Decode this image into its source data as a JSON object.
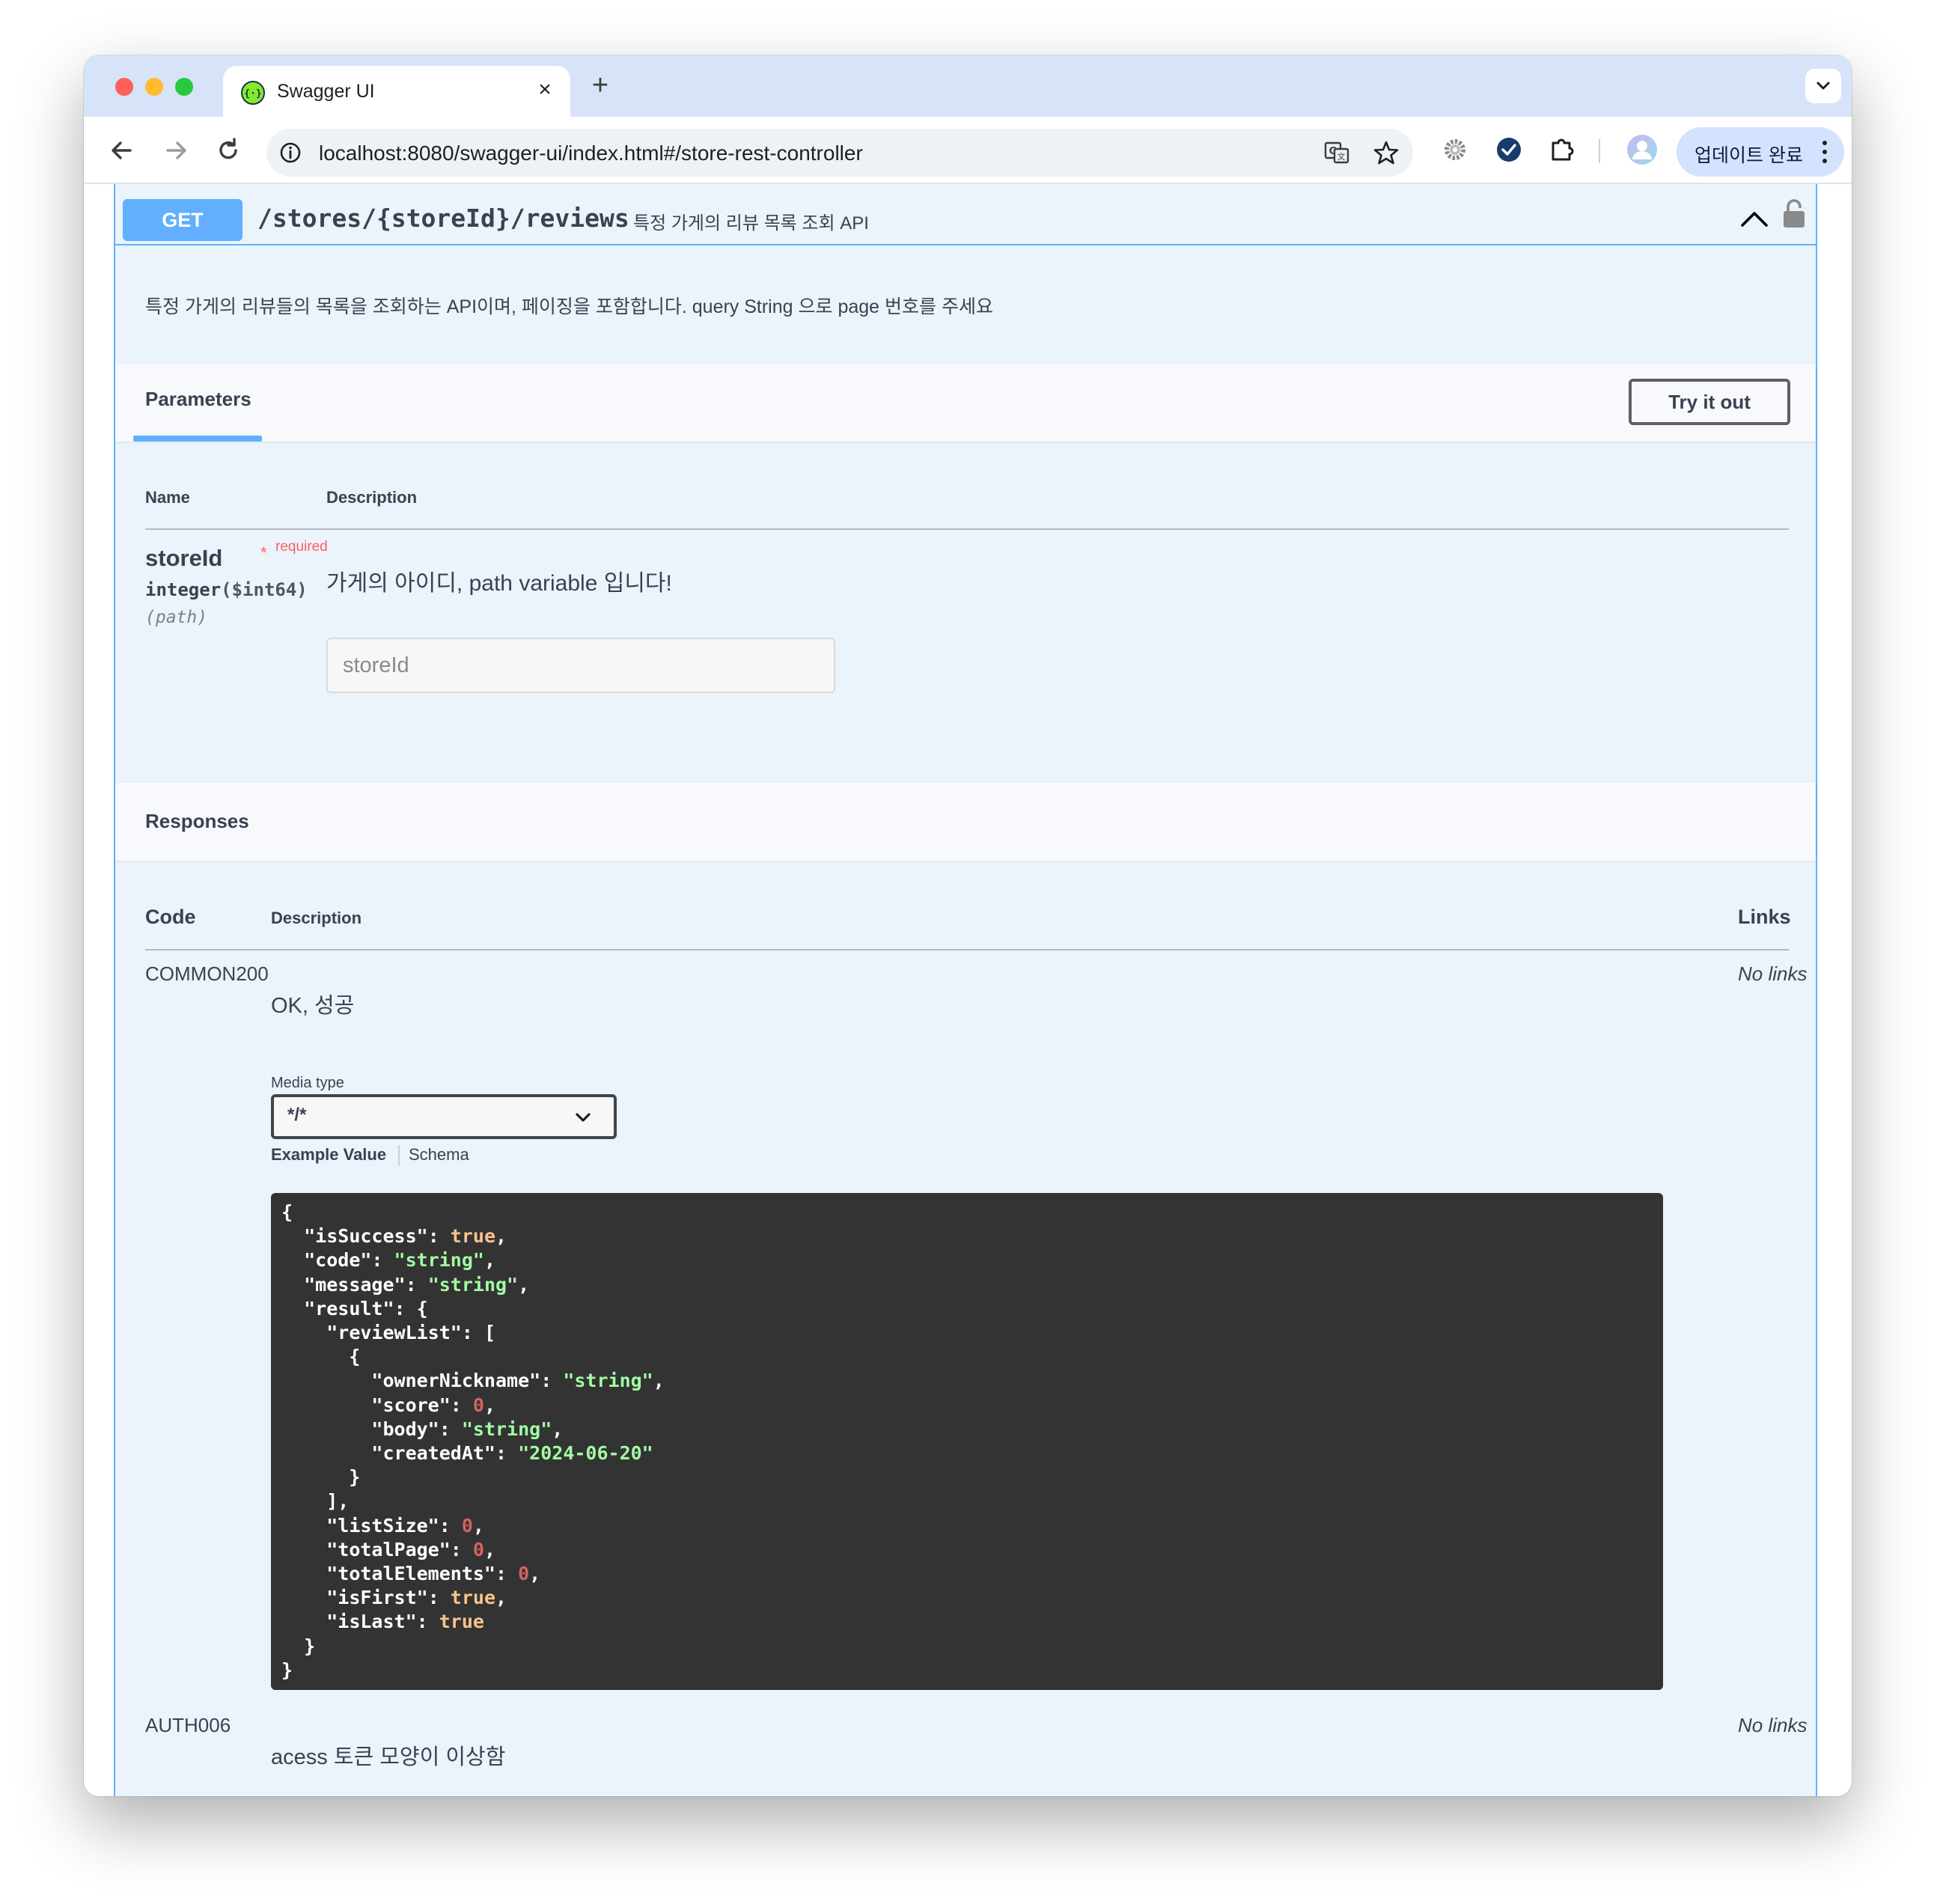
{
  "browser": {
    "tab_title": "Swagger UI",
    "tab_close": "×",
    "new_tab": "+",
    "url": "localhost:8080/swagger-ui/index.html#/store-rest-controller",
    "update_button": "업데이트 완료"
  },
  "operation": {
    "method": "GET",
    "path": "/stores/{storeId}/reviews",
    "summary": "특정 가게의 리뷰 목록 조회 API",
    "description": "특정 가게의 리뷰들의 목록을 조회하는 API이며, 페이징을 포함합니다. query String 으로 page 번호를 주세요"
  },
  "parameters": {
    "tab_label": "Parameters",
    "try_it_out": "Try it out",
    "col_name": "Name",
    "col_description": "Description",
    "items": [
      {
        "name": "storeId",
        "required_star": "*",
        "required_label": "required",
        "type": "integer",
        "format": "($int64)",
        "in": "(path)",
        "description": "가게의 아이디, path variable 입니다!",
        "placeholder": "storeId"
      }
    ]
  },
  "responses": {
    "title": "Responses",
    "col_code": "Code",
    "col_description": "Description",
    "col_links": "Links",
    "media_type_label": "Media type",
    "media_type_value": "*/*",
    "example_value_tab": "Example Value",
    "schema_tab": "Schema",
    "items": [
      {
        "code": "COMMON200",
        "description": "OK, 성공",
        "links": "No links"
      },
      {
        "code": "AUTH006",
        "description": "acess 토큰 모양이 이상함",
        "links": "No links"
      }
    ],
    "example": {
      "isSuccess": "true",
      "code": "\"string\"",
      "message": "\"string\"",
      "ownerNickname": "\"string\"",
      "score": "0",
      "body": "\"string\"",
      "createdAt": "\"2024-06-20\"",
      "listSize": "0",
      "totalPage": "0",
      "totalElements": "0",
      "isFirst": "true",
      "isLast": "true"
    }
  },
  "colors": {
    "get_method": "#61affe",
    "opblock_bg": "#ebf3fb",
    "code_bg": "#333333",
    "code_string": "#a2fca2",
    "code_boolean": "#fcc28c",
    "code_number": "#d36363",
    "required": "#ff6060"
  },
  "icons": [
    "swagger-favicon",
    "back-arrow-icon",
    "forward-arrow-icon",
    "reload-icon",
    "site-info-icon",
    "translate-icon",
    "star-icon",
    "extension-gear-icon",
    "checkmark-badge-icon",
    "puzzle-extensions-icon",
    "profile-avatar",
    "more-vert-icon",
    "chevron-up-icon",
    "lock-icon",
    "chevron-down-icon"
  ]
}
